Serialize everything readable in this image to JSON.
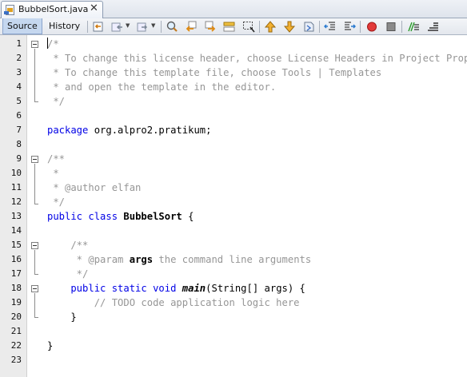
{
  "tab": {
    "filename": "BubbelSort.java",
    "close": "✕"
  },
  "toolbar": {
    "source_label": "Source",
    "history_label": "History"
  },
  "editor": {
    "line_numbers": [
      "1",
      "2",
      "3",
      "4",
      "5",
      "6",
      "7",
      "8",
      "9",
      "10",
      "11",
      "12",
      "13",
      "14",
      "15",
      "16",
      "17",
      "18",
      "19",
      "20",
      "21",
      "22",
      "23"
    ],
    "lines": {
      "l1": "/*",
      "l2": " * To change this license header, choose License Headers in Project Properties.",
      "l3": " * To change this template file, choose Tools | Templates",
      "l4": " * and open the template in the editor.",
      "l5": " */",
      "l7_kw": "package",
      "l7_rest": " org.alpro2.pratikum;",
      "l9": "/**",
      "l10": " *",
      "l11": " * @author elfan",
      "l12": " */",
      "l13_kw": "public class",
      "l13_name": " BubbelSort",
      "l13_rest": " {",
      "l15": "    /**",
      "l16_a": "     * @param ",
      "l16_b": "args",
      "l16_c": " the command line arguments",
      "l17": "     */",
      "l18_kw": "    public static void",
      "l18_sp": " ",
      "l18_name": "main",
      "l18_rest": "(String[] args) {",
      "l19": "        // TODO code application logic here",
      "l20": "    }",
      "l22": "}"
    }
  },
  "colors": {
    "keyword": "#0000e6",
    "comment": "#969696",
    "gutter": "#ebebeb"
  }
}
